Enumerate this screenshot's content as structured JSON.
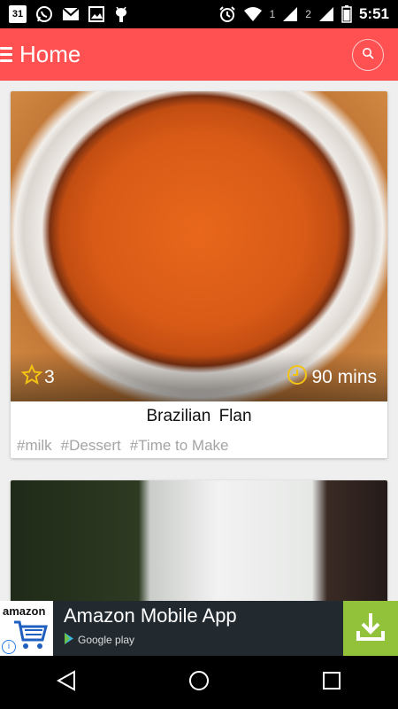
{
  "status_bar": {
    "calendar_day": "31",
    "sim1": "1",
    "sim2": "2",
    "time": "5:51",
    "icons": [
      "calendar-icon",
      "whatsapp-icon",
      "gmail-icon",
      "gallery-icon",
      "android-debug-icon",
      "alarm-icon",
      "wifi-icon",
      "signal-icon",
      "battery-icon"
    ]
  },
  "app_bar": {
    "title": "Home",
    "color": "#ff5152",
    "icons": [
      "menu-icon",
      "search-icon"
    ]
  },
  "recipes": [
    {
      "title": "Brazilian Flan",
      "rating": "3",
      "duration": "90 mins",
      "tags": [
        "#milk",
        "#Dessert",
        "#Time to Make"
      ]
    }
  ],
  "ad": {
    "logo_text": "amazon",
    "title": "Amazon Mobile App",
    "store_label": "Google play",
    "info_label": "i",
    "accent_color": "#92c23a"
  },
  "nav_bar": {
    "icons": [
      "back-icon",
      "home-icon",
      "recents-icon"
    ]
  }
}
